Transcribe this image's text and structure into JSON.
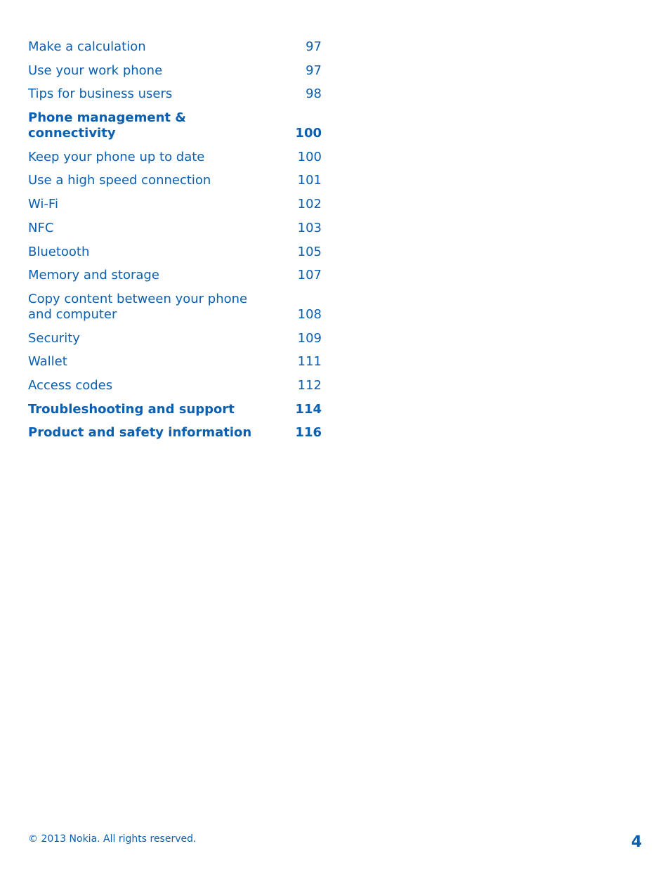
{
  "toc": [
    {
      "title": "Make a calculation",
      "page": "97",
      "bold": false
    },
    {
      "title": "Use your work phone",
      "page": "97",
      "bold": false
    },
    {
      "title": "Tips for business users",
      "page": "98",
      "bold": false
    },
    {
      "title": "Phone management & connectivity",
      "page": "100",
      "bold": true
    },
    {
      "title": "Keep your phone up to date",
      "page": "100",
      "bold": false
    },
    {
      "title": "Use a high speed connection",
      "page": "101",
      "bold": false
    },
    {
      "title": "Wi-Fi",
      "page": "102",
      "bold": false
    },
    {
      "title": "NFC",
      "page": "103",
      "bold": false
    },
    {
      "title": "Bluetooth",
      "page": "105",
      "bold": false
    },
    {
      "title": "Memory and storage",
      "page": "107",
      "bold": false
    },
    {
      "title": "Copy content between your phone and computer",
      "page": "108",
      "bold": false
    },
    {
      "title": "Security",
      "page": "109",
      "bold": false
    },
    {
      "title": "Wallet",
      "page": "111",
      "bold": false
    },
    {
      "title": "Access codes",
      "page": "112",
      "bold": false
    },
    {
      "title": "Troubleshooting and support",
      "page": "114",
      "bold": true
    },
    {
      "title": "Product and safety information",
      "page": "116",
      "bold": true
    }
  ],
  "footer": {
    "copyright": "© 2013 Nokia. All rights reserved.",
    "page_number": "4"
  }
}
